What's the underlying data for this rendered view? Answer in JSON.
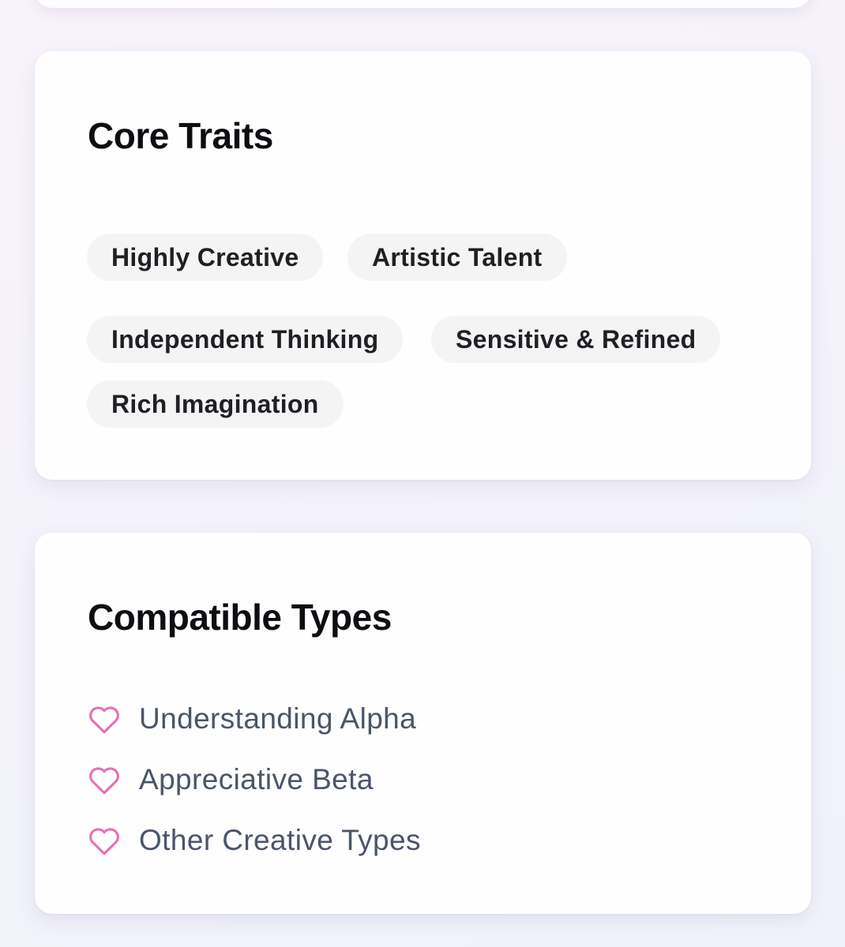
{
  "traits_card": {
    "title": "Core Traits",
    "chips": [
      "Highly Creative",
      "Artistic Talent",
      "Independent Thinking",
      "Sensitive & Refined",
      "Rich Imagination"
    ]
  },
  "compat_card": {
    "title": "Compatible Types",
    "items": [
      {
        "label": "Understanding Alpha",
        "icon": "heart-outline-icon"
      },
      {
        "label": "Appreciative Beta",
        "icon": "heart-outline-icon"
      },
      {
        "label": "Other Creative Types",
        "icon": "heart-outline-icon"
      }
    ]
  },
  "colors": {
    "heart": "#e472b4",
    "chip_bg": "#f4f4f5",
    "title": "#0d0d12",
    "list_text": "#4a5568"
  }
}
